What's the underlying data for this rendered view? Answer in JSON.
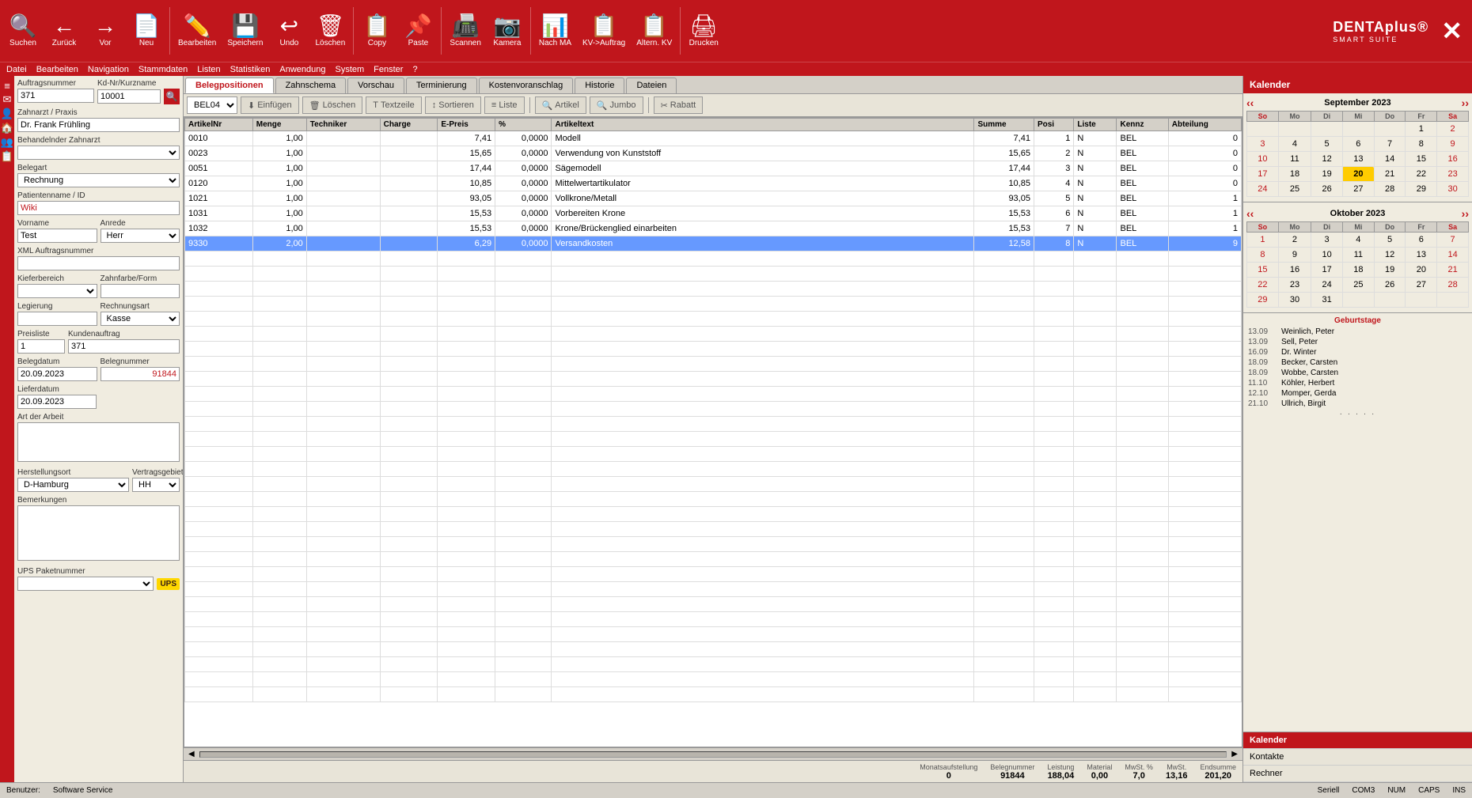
{
  "app": {
    "title": "DENTAplus®",
    "subtitle": "SMART SUITE"
  },
  "menubar": {
    "items": [
      "Datei",
      "Bearbeiten",
      "Navigation",
      "Stammdaten",
      "Listen",
      "Statistiken",
      "Anwendung",
      "System",
      "Fenster",
      "?"
    ]
  },
  "toolbar": {
    "buttons": [
      {
        "id": "suchen",
        "label": "Suchen",
        "icon": "🔍"
      },
      {
        "id": "zurueck",
        "label": "Zurück",
        "icon": "←"
      },
      {
        "id": "vor",
        "label": "Vor",
        "icon": "→"
      },
      {
        "id": "neu",
        "label": "Neu",
        "icon": "📄"
      },
      {
        "id": "bearbeiten",
        "label": "Bearbeiten",
        "icon": "✏️"
      },
      {
        "id": "speichern",
        "label": "Speichern",
        "icon": "💾"
      },
      {
        "id": "undo",
        "label": "Undo",
        "icon": "↩"
      },
      {
        "id": "loeschen",
        "label": "Löschen",
        "icon": "🗑"
      },
      {
        "id": "copy",
        "label": "Copy",
        "icon": "📋"
      },
      {
        "id": "paste",
        "label": "Paste",
        "icon": "📌"
      },
      {
        "id": "scannen",
        "label": "Scannen",
        "icon": "📠"
      },
      {
        "id": "kamera",
        "label": "Kamera",
        "icon": "📷"
      },
      {
        "id": "nach-ma",
        "label": "Nach MA",
        "icon": "📊"
      },
      {
        "id": "kv-auftrag",
        "label": "KV->Auftrag",
        "icon": "📋"
      },
      {
        "id": "altern-kv",
        "label": "Altern. KV",
        "icon": "📋"
      },
      {
        "id": "drucken",
        "label": "Drucken",
        "icon": "🖨"
      }
    ]
  },
  "sidebar_icons": [
    "≡",
    "✉",
    "👤",
    "🏠",
    "👥",
    "📋"
  ],
  "left_panel": {
    "auftragsnummer_label": "Auftragsnummer",
    "auftragsnummer_value": "371",
    "kd_nr_label": "Kd-Nr/Kurzname",
    "kd_nr_value": "10001",
    "zahnarzt_label": "Zahnarzt / Praxis",
    "zahnarzt_value": "Dr. Frank Frühling",
    "behandelnder_label": "Behandelnder Zahnarzt",
    "behandelnder_value": "",
    "belegart_label": "Belegart",
    "belegart_value": "Rechnung",
    "patientenname_label": "Patientenname / ID",
    "patientenname_value": "Wiki",
    "vorname_label": "Vorname",
    "vorname_value": "Test",
    "anrede_label": "Anrede",
    "anrede_value": "Herr",
    "xml_label": "XML Auftragsnummer",
    "xml_value": "",
    "kieferbereich_label": "Kieferbereich",
    "kieferbereich_value": "",
    "zahnfarbe_label": "Zahnfarbe/Form",
    "zahnfarbe_value": "",
    "legierung_label": "Legierung",
    "legierung_value": "",
    "rechnungsart_label": "Rechnungsart",
    "rechnungsart_value": "Kasse",
    "preisliste_label": "Preisliste",
    "preisliste_value": "1",
    "kundenauftrag_label": "Kundenauftrag",
    "kundenauftrag_value": "371",
    "belegdatum_label": "Belegdatum",
    "belegdatum_value": "20.09.2023",
    "belegnummer_label": "Belegnummer",
    "belegnummer_value": "91844",
    "lieferdatum_label": "Lieferdatum",
    "lieferdatum_value": "20.09.2023",
    "art_arbeit_label": "Art der Arbeit",
    "art_arbeit_value": "",
    "herstellungsort_label": "Herstellungsort",
    "herstellungsort_value": "D-Hamburg",
    "vertragsgebiet_label": "Vertragsgebiet",
    "vertragsgebiet_value": "HH",
    "bemerkungen_label": "Bemerkungen",
    "bemerkungen_value": "",
    "ups_label": "UPS Paketnummer",
    "ups_value": ""
  },
  "tabs": [
    {
      "id": "belegpositionen",
      "label": "Belegpositionen",
      "active": true
    },
    {
      "id": "zahnschema",
      "label": "Zahnschema",
      "active": false
    },
    {
      "id": "vorschau",
      "label": "Vorschau",
      "active": false
    },
    {
      "id": "terminierung",
      "label": "Terminierung",
      "active": false
    },
    {
      "id": "kostenvoranschlag",
      "label": "Kostenvoranschlag",
      "active": false
    },
    {
      "id": "historie",
      "label": "Historie",
      "active": false
    },
    {
      "id": "dateien",
      "label": "Dateien",
      "active": false
    }
  ],
  "beleg_toolbar": {
    "type_value": "BEL04",
    "buttons": [
      {
        "id": "einfuegen",
        "label": "Einfügen",
        "icon": "📥",
        "disabled": false
      },
      {
        "id": "loeschen",
        "label": "Löschen",
        "icon": "🗑",
        "disabled": false
      },
      {
        "id": "textzeile",
        "label": "Textzeile",
        "icon": "T",
        "disabled": false
      },
      {
        "id": "sortieren",
        "label": "Sortieren",
        "icon": "↕",
        "disabled": false
      },
      {
        "id": "liste",
        "label": "Liste",
        "icon": "≡",
        "disabled": false
      },
      {
        "id": "artikel",
        "label": "Artikel",
        "icon": "🔍",
        "disabled": false
      },
      {
        "id": "jumbo",
        "label": "Jumbo",
        "icon": "🔍",
        "disabled": false
      },
      {
        "id": "rabatt",
        "label": "Rabatt",
        "icon": "✂",
        "disabled": false
      }
    ]
  },
  "table": {
    "columns": [
      "ArtikelNr",
      "Menge",
      "Techniker",
      "Charge",
      "E-Preis",
      "%",
      "Artikeltext",
      "Summe",
      "Posi",
      "Liste",
      "Kennz",
      "Abteilung"
    ],
    "rows": [
      {
        "artikelnr": "0010",
        "menge": "1,00",
        "techniker": "",
        "charge": "",
        "epreis": "7,41",
        "prozent": "0,0000",
        "artikeltext": "Modell",
        "summe": "7,41",
        "posi": "1",
        "liste": "N",
        "kennz": "BEL",
        "abteilung": "0",
        "selected": false
      },
      {
        "artikelnr": "0023",
        "menge": "1,00",
        "techniker": "",
        "charge": "",
        "epreis": "15,65",
        "prozent": "0,0000",
        "artikeltext": "Verwendung von Kunststoff",
        "summe": "15,65",
        "posi": "2",
        "liste": "N",
        "kennz": "BEL",
        "abteilung": "0",
        "selected": false
      },
      {
        "artikelnr": "0051",
        "menge": "1,00",
        "techniker": "",
        "charge": "",
        "epreis": "17,44",
        "prozent": "0,0000",
        "artikeltext": "Sägemodell",
        "summe": "17,44",
        "posi": "3",
        "liste": "N",
        "kennz": "BEL",
        "abteilung": "0",
        "selected": false
      },
      {
        "artikelnr": "0120",
        "menge": "1,00",
        "techniker": "",
        "charge": "",
        "epreis": "10,85",
        "prozent": "0,0000",
        "artikeltext": "Mittelwertartikulator",
        "summe": "10,85",
        "posi": "4",
        "liste": "N",
        "kennz": "BEL",
        "abteilung": "0",
        "selected": false
      },
      {
        "artikelnr": "1021",
        "menge": "1,00",
        "techniker": "",
        "charge": "",
        "epreis": "93,05",
        "prozent": "0,0000",
        "artikeltext": "Vollkrone/Metall",
        "summe": "93,05",
        "posi": "5",
        "liste": "N",
        "kennz": "BEL",
        "abteilung": "1",
        "selected": false
      },
      {
        "artikelnr": "1031",
        "menge": "1,00",
        "techniker": "",
        "charge": "",
        "epreis": "15,53",
        "prozent": "0,0000",
        "artikeltext": "Vorbereiten Krone",
        "summe": "15,53",
        "posi": "6",
        "liste": "N",
        "kennz": "BEL",
        "abteilung": "1",
        "selected": false
      },
      {
        "artikelnr": "1032",
        "menge": "1,00",
        "techniker": "",
        "charge": "",
        "epreis": "15,53",
        "prozent": "0,0000",
        "artikeltext": "Krone/Brückenglied einarbeiten",
        "summe": "15,53",
        "posi": "7",
        "liste": "N",
        "kennz": "BEL",
        "abteilung": "1",
        "selected": false
      },
      {
        "artikelnr": "9330",
        "menge": "2,00",
        "techniker": "",
        "charge": "",
        "epreis": "6,29",
        "prozent": "0,0000",
        "artikeltext": "Versandkosten",
        "summe": "12,58",
        "posi": "8",
        "liste": "N",
        "kennz": "BEL",
        "abteilung": "9",
        "selected": true
      }
    ]
  },
  "summary": {
    "monatsaufstellung_label": "Monatsaufstellung",
    "monatsaufstellung_value": "0",
    "belegnummer_label": "Belegnummer",
    "belegnummer_value": "91844",
    "leistung_label": "Leistung",
    "leistung_value": "188,04",
    "material_label": "Material",
    "material_value": "0,00",
    "mwst_pct_label": "MwSt. %",
    "mwst_pct_value": "7,0",
    "mwst_label": "MwSt.",
    "mwst_value": "13,16",
    "endsumme_label": "Endsumme",
    "endsumme_value": "201,20"
  },
  "status_bar": {
    "benutzer_label": "Benutzer:",
    "benutzer_value": "Software Service",
    "seriell_label": "Seriell",
    "seriell_value": "",
    "com3_label": "COM3",
    "num_label": "NUM",
    "caps_label": "CAPS",
    "ins_label": "INS"
  },
  "calendar": {
    "title": "Kalender",
    "month1": {
      "title": "September 2023",
      "days_header": [
        "So",
        "Mo",
        "Di",
        "Mi",
        "Do",
        "Fr",
        "Sa"
      ],
      "weeks": [
        [
          "",
          "",
          "",
          "",
          "",
          "1",
          "2"
        ],
        [
          "3",
          "4",
          "5",
          "6",
          "7",
          "8",
          "9"
        ],
        [
          "10",
          "11",
          "12",
          "13",
          "14",
          "15",
          "16"
        ],
        [
          "17",
          "18",
          "19",
          "20",
          "21",
          "22",
          "23"
        ],
        [
          "24",
          "25",
          "26",
          "27",
          "28",
          "29",
          "30"
        ]
      ],
      "today": "20"
    },
    "month2": {
      "title": "Oktober 2023",
      "days_header": [
        "So",
        "Mo",
        "Di",
        "Mi",
        "Do",
        "Fr",
        "Sa"
      ],
      "weeks": [
        [
          "1",
          "2",
          "3",
          "4",
          "5",
          "6",
          "7"
        ],
        [
          "8",
          "9",
          "10",
          "11",
          "12",
          "13",
          "14"
        ],
        [
          "15",
          "16",
          "17",
          "18",
          "19",
          "20",
          "21"
        ],
        [
          "22",
          "23",
          "24",
          "25",
          "26",
          "27",
          "28"
        ],
        [
          "29",
          "30",
          "31",
          "",
          "",
          "",
          ""
        ]
      ]
    },
    "geburtstage": [
      {
        "date": "13.09",
        "name": "Weinlich, Peter"
      },
      {
        "date": "13.09",
        "name": "Sell, Peter"
      },
      {
        "date": "16.09",
        "name": "Dr. Winter"
      },
      {
        "date": "18.09",
        "name": "Becker, Carsten"
      },
      {
        "date": "18.09",
        "name": "Wobbe, Carsten"
      },
      {
        "date": "11.10",
        "name": "Köhler, Herbert"
      },
      {
        "date": "12.10",
        "name": "Momper, Gerda"
      },
      {
        "date": "21.10",
        "name": "Ullrich, Birgit"
      }
    ],
    "geburtstage_title": "Geburtstage",
    "bottom_items": [
      {
        "id": "kalender",
        "label": "Kalender"
      },
      {
        "id": "kontakte",
        "label": "Kontakte"
      },
      {
        "id": "rechner",
        "label": "Rechner"
      }
    ]
  }
}
